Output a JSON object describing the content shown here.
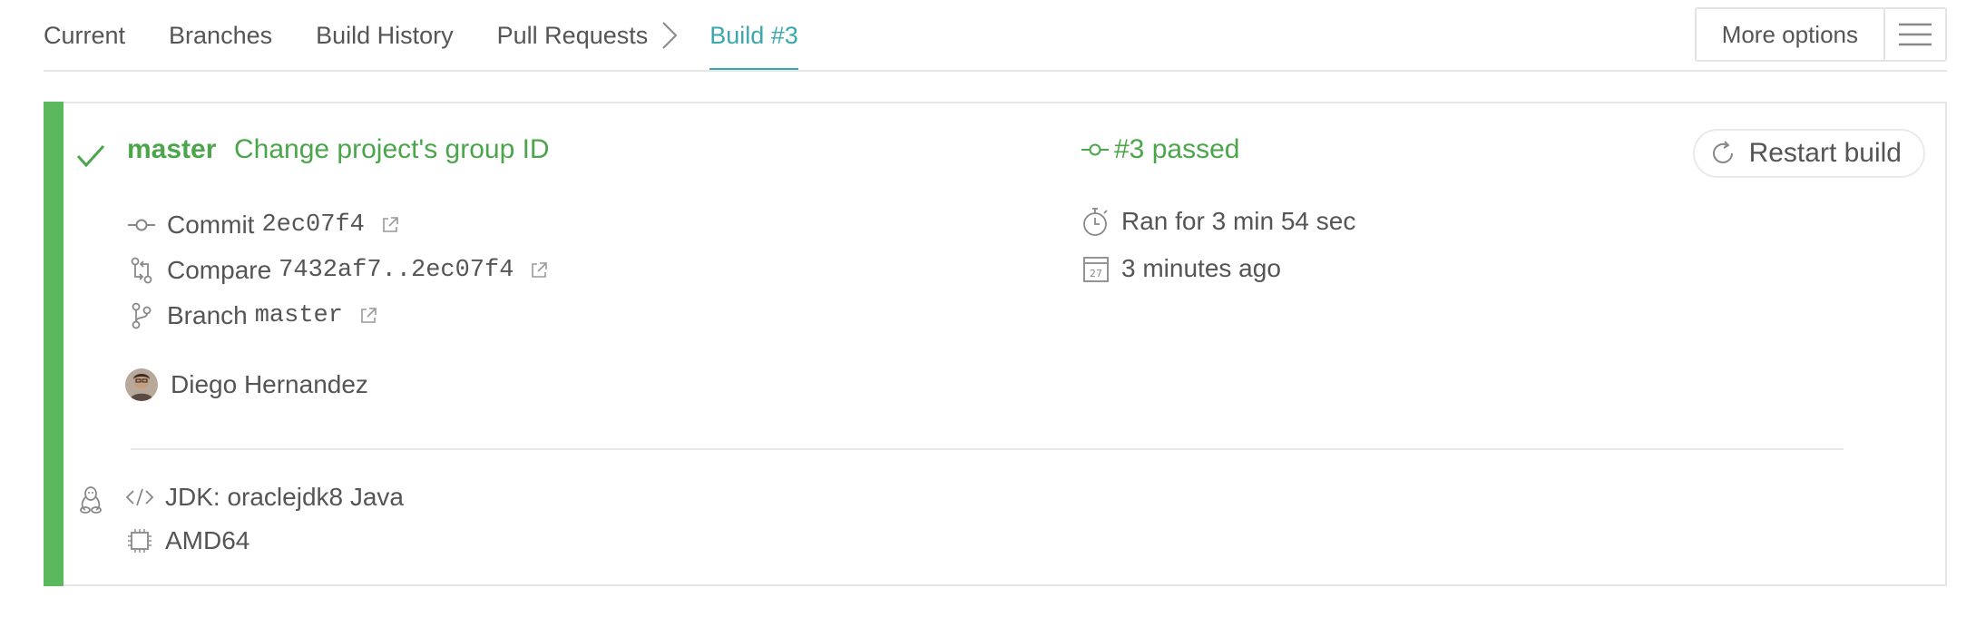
{
  "tabs": [
    {
      "label": "Current"
    },
    {
      "label": "Branches"
    },
    {
      "label": "Build History"
    },
    {
      "label": "Pull Requests"
    }
  ],
  "active_tab": {
    "label": "Build #3"
  },
  "more_options": {
    "label": "More options"
  },
  "build": {
    "branch": "master",
    "message": "Change project's group ID",
    "status": "#3 passed",
    "restart_label": "Restart build",
    "commit": {
      "label": "Commit",
      "sha": "2ec07f4"
    },
    "compare": {
      "label": "Compare",
      "range": "7432af7..2ec07f4"
    },
    "branch_row": {
      "label": "Branch",
      "name": "master"
    },
    "author": "Diego Hernandez",
    "duration": "Ran for 3 min 54 sec",
    "finished": "3 minutes ago",
    "calendar_day": "27",
    "jdk": "JDK: oraclejdk8 Java",
    "arch": "AMD64"
  },
  "colors": {
    "accent": "#3aa9ad",
    "passed": "#4ba64b",
    "passed_bar": "#5cb85c"
  }
}
